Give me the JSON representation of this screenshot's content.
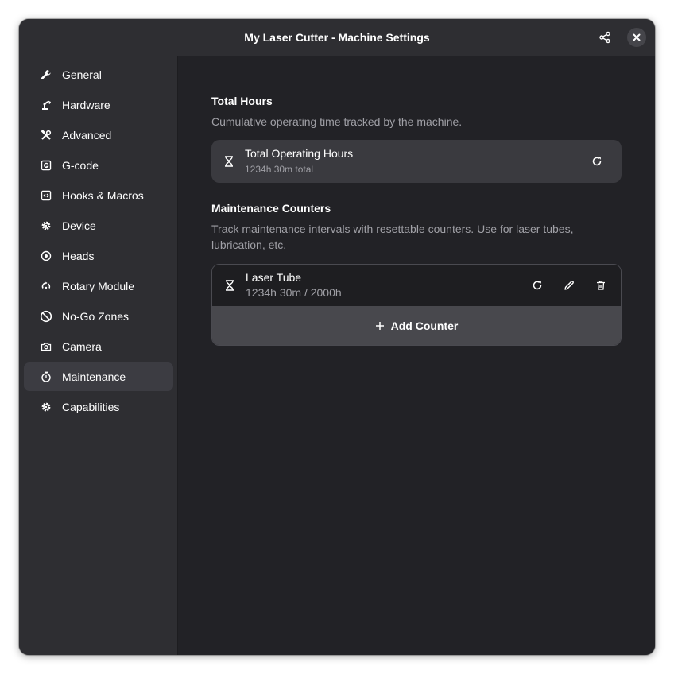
{
  "window": {
    "title": "My Laser Cutter - Machine Settings"
  },
  "header": {
    "share_icon": "share-icon",
    "close_icon": "close-icon"
  },
  "sidebar": {
    "active": "Maintenance",
    "items": [
      {
        "label": "General",
        "icon": "wrench-icon"
      },
      {
        "label": "Hardware",
        "icon": "robot-arm-icon"
      },
      {
        "label": "Advanced",
        "icon": "tools-icon"
      },
      {
        "label": "G-code",
        "icon": "gcode-icon"
      },
      {
        "label": "Hooks & Macros",
        "icon": "code-icon"
      },
      {
        "label": "Device",
        "icon": "gear-icon"
      },
      {
        "label": "Heads",
        "icon": "target-icon"
      },
      {
        "label": "Rotary Module",
        "icon": "rotate-icon"
      },
      {
        "label": "No-Go Zones",
        "icon": "forbidden-icon"
      },
      {
        "label": "Camera",
        "icon": "camera-icon"
      },
      {
        "label": "Maintenance",
        "icon": "stopwatch-icon"
      },
      {
        "label": "Capabilities",
        "icon": "gear-icon"
      }
    ]
  },
  "total_hours": {
    "title": "Total Hours",
    "description": "Cumulative operating time tracked by the machine.",
    "row_title": "Total Operating Hours",
    "row_subtitle": "1234h 30m total",
    "icon": "hourglass-icon",
    "action_icon": "refresh-icon"
  },
  "maintenance": {
    "title": "Maintenance Counters",
    "description": "Track maintenance intervals with resettable counters. Use for laser tubes, lubrication, etc.",
    "counters": [
      {
        "name": "Laser Tube",
        "value": "1234h 30m / 2000h",
        "icon": "hourglass-icon",
        "actions": [
          "refresh-icon",
          "pencil-icon",
          "trash-icon"
        ]
      }
    ],
    "add_label": "Add Counter",
    "add_icon": "plus-icon"
  },
  "colors": {
    "window_bg": "#222226",
    "sidebar_bg": "#2e2e32",
    "card_bg": "#3a3a3f",
    "active_item_bg": "#3c3c42",
    "muted_text": "#a0a0a6",
    "text": "#ffffff"
  }
}
